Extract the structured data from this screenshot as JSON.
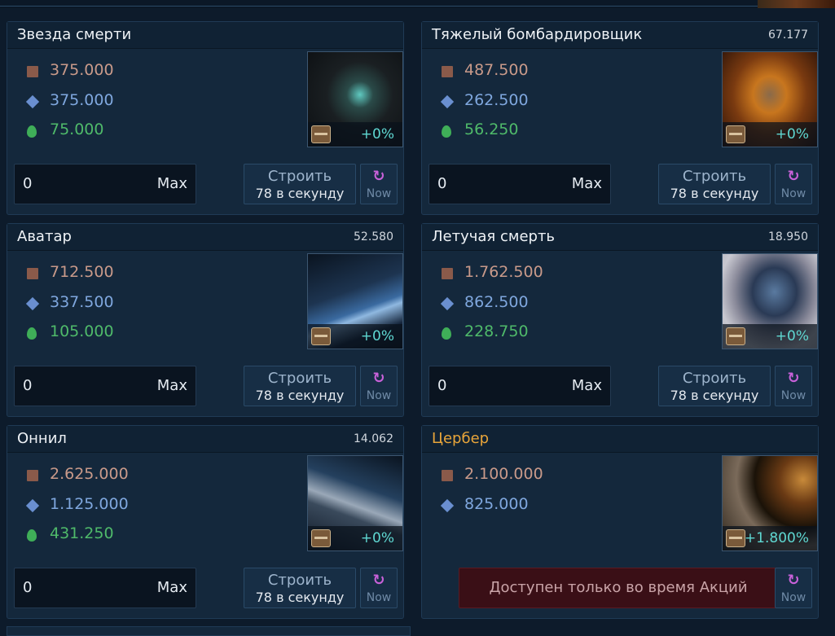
{
  "ships": [
    {
      "name": "Звезда смерти",
      "count": "",
      "metal": "375.000",
      "crystal": "375.000",
      "deuterium": "75.000",
      "bonus": "+0%",
      "qty": "0",
      "max_label": "Max",
      "build_label": "Строить",
      "rate_label": "78 в секунду",
      "now_label": "Now"
    },
    {
      "name": "Тяжелый бомбардировщик",
      "count": "67.177",
      "metal": "487.500",
      "crystal": "262.500",
      "deuterium": "56.250",
      "bonus": "+0%",
      "qty": "0",
      "max_label": "Max",
      "build_label": "Строить",
      "rate_label": "78 в секунду",
      "now_label": "Now"
    },
    {
      "name": "Аватар",
      "count": "52.580",
      "metal": "712.500",
      "crystal": "337.500",
      "deuterium": "105.000",
      "bonus": "+0%",
      "qty": "0",
      "max_label": "Max",
      "build_label": "Строить",
      "rate_label": "78 в секунду",
      "now_label": "Now"
    },
    {
      "name": "Летучая смерть",
      "count": "18.950",
      "metal": "1.762.500",
      "crystal": "862.500",
      "deuterium": "228.750",
      "bonus": "+0%",
      "qty": "0",
      "max_label": "Max",
      "build_label": "Строить",
      "rate_label": "78 в секунду",
      "now_label": "Now"
    },
    {
      "name": "Оннил",
      "count": "14.062",
      "metal": "2.625.000",
      "crystal": "1.125.000",
      "deuterium": "431.250",
      "bonus": "+0%",
      "qty": "0",
      "max_label": "Max",
      "build_label": "Строить",
      "rate_label": "78 в секунду",
      "now_label": "Now"
    },
    {
      "name": "Цербер",
      "count": "",
      "metal": "2.100.000",
      "crystal": "825.000",
      "bonus": "+1.800%",
      "promo_label": "Доступен только во время Акций",
      "now_label": "Now",
      "title_color": "#e8a53a"
    }
  ],
  "icons": {
    "metal": "metal-icon",
    "crystal": "crystal-icon",
    "deuterium": "deuterium-icon",
    "now": "refresh-icon",
    "bonus_chest": "chest-icon"
  },
  "colors": {
    "metal": "#c99a8a",
    "crystal": "#7fa7de",
    "deuterium": "#4fba6a",
    "bonus": "#5fd8d2",
    "now_icon": "#c861d9",
    "promo_bg": "#3a0f16"
  }
}
